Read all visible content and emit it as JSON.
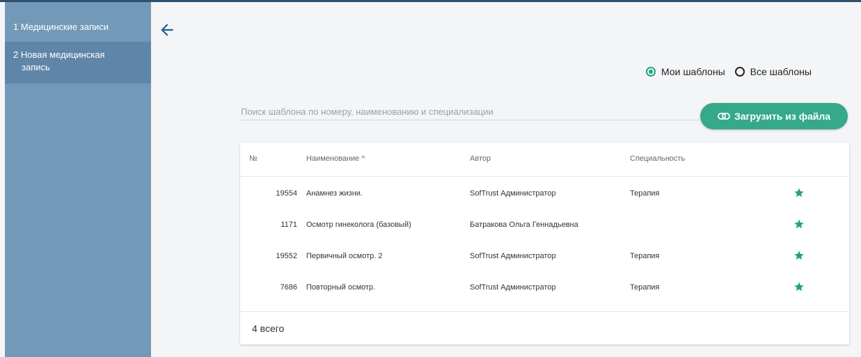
{
  "sidebar": {
    "items": [
      {
        "label": "1 Медицинские записи"
      },
      {
        "label_line1": "2 Новая медицинская",
        "label_line2": "запись"
      }
    ]
  },
  "filters": {
    "my_templates": "Мои шаблоны",
    "all_templates": "Все шаблоны",
    "selected": "my_templates"
  },
  "search": {
    "placeholder": "Поиск шаблона по номеру, наименованию и специализации",
    "value": ""
  },
  "upload_button": {
    "label": "Загрузить из файла"
  },
  "table": {
    "headers": {
      "number": "№",
      "name": "Наименование ^",
      "author": "Автор",
      "specialty": "Специальность"
    },
    "rows": [
      {
        "number": "19554",
        "name": "Анамнез жизни.",
        "author": "SofTrust Администратор",
        "specialty": "Терапия"
      },
      {
        "number": "1171",
        "name": "Осмотр гинеколога (базовый)",
        "author": "Батракова Ольга Геннадьевна",
        "specialty": ""
      },
      {
        "number": "19552",
        "name": "Первичный осмотр. 2",
        "author": "SofTrust Администратор",
        "specialty": "Терапия"
      },
      {
        "number": "7686",
        "name": "Повторный осмотр.",
        "author": "SofTrust Администратор",
        "specialty": "Терапия"
      }
    ],
    "total": "4 всего"
  },
  "icons": {
    "back": "arrow-left-icon",
    "upload": "link-icon",
    "favorite": "star-icon"
  },
  "colors": {
    "accent": "#35a98a",
    "sidebar": "#7399b8",
    "sidebar_active": "#5f86a8",
    "star": "#1da47f"
  }
}
